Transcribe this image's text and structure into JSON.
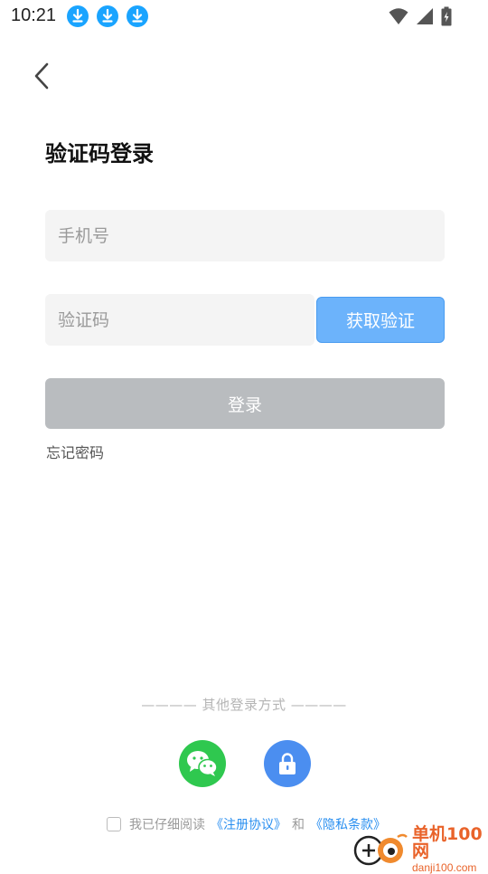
{
  "status_bar": {
    "time": "10:21",
    "download_icon_color": "#1aa4ff"
  },
  "header": {
    "title": "验证码登录"
  },
  "form": {
    "phone_placeholder": "手机号",
    "code_placeholder": "验证码",
    "get_code_label": "获取验证",
    "login_label": "登录",
    "forgot_password_label": "忘记密码"
  },
  "other_login": {
    "label": "———— 其他登录方式 ————",
    "methods": [
      "wechat-icon",
      "lock-icon"
    ]
  },
  "agreement": {
    "prefix": "我已仔细阅读",
    "terms_label": "《注册协议》",
    "connector": "和",
    "privacy_label": "《隐私条款》",
    "checked": false
  },
  "watermark": {
    "title": "单机100网",
    "domain": "danji100.com"
  },
  "colors": {
    "primary_blue": "#6cb3fb",
    "login_disabled": "#b9bcbf",
    "wechat_green": "#2fc84f",
    "lock_blue": "#4b8ef0",
    "link_blue": "#2a8ff0"
  }
}
